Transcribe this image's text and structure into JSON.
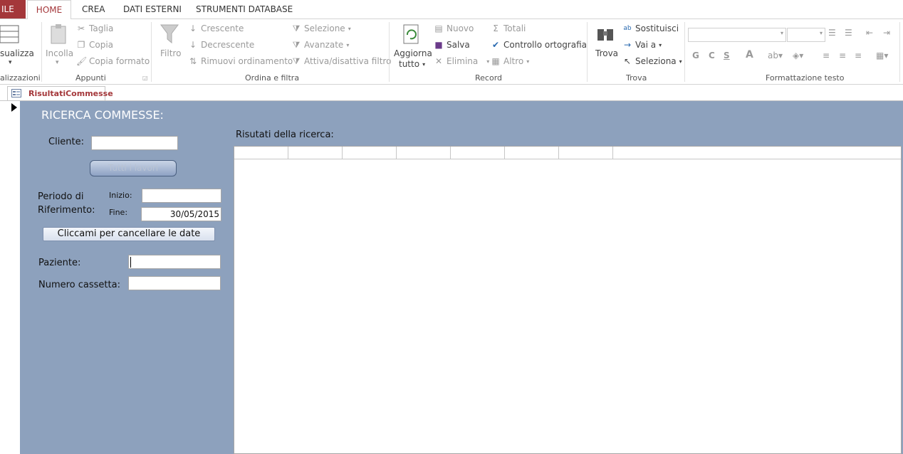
{
  "tabs": [
    {
      "label": "ILE"
    },
    {
      "label": "HOME"
    },
    {
      "label": "CREA"
    },
    {
      "label": "DATI ESTERNI"
    },
    {
      "label": "STRUMENTI DATABASE"
    }
  ],
  "ribbon": {
    "views": {
      "button": "sualizza",
      "group": "alizzazioni"
    },
    "clipboard": {
      "paste": "Incolla",
      "cut": "Taglia",
      "copy": "Copia",
      "format_painter": "Copia formato",
      "group": "Appunti"
    },
    "sort": {
      "filter": "Filtro",
      "asc": "Crescente",
      "desc": "Decrescente",
      "remove": "Rimuovi ordinamento",
      "selection": "Selezione",
      "advanced": "Avanzate",
      "toggle": "Attiva/disattiva filtro",
      "group": "Ordina e filtra"
    },
    "record": {
      "refresh": "Aggiorna",
      "refresh2": "tutto",
      "new": "Nuovo",
      "save": "Salva",
      "delete": "Elimina",
      "totals": "Totali",
      "spelling": "Controllo ortografia",
      "more": "Altro",
      "group": "Record"
    },
    "find": {
      "find": "Trova",
      "replace": "Sostituisci",
      "goto": "Vai a",
      "select": "Seleziona",
      "group": "Trova"
    },
    "text_format": {
      "bold": "G",
      "italic": "C",
      "underline": "S",
      "font_color": "A",
      "group": "Formattazione testo"
    }
  },
  "doc_tab": {
    "label": "RisultatiCommesse"
  },
  "form": {
    "title": "RICERCA COMMESSE:",
    "client_label": "Cliente:",
    "all_button": "Tutti i lavori",
    "period_label_1": "Periodo di",
    "period_label_2": "Riferimento:",
    "start_label": "Inizio:",
    "start_value": "",
    "end_label": "Fine:",
    "end_value": "30/05/2015",
    "clear_dates_button": "Cliccami per cancellare le date",
    "patient_label": "Paziente:",
    "box_label": "Numero cassetta:",
    "results_label": "Risutati della ricerca:"
  },
  "colors": {
    "file_tab": "#a4373a",
    "form_bg": "#8da1bd",
    "accent": "#a4373a"
  }
}
